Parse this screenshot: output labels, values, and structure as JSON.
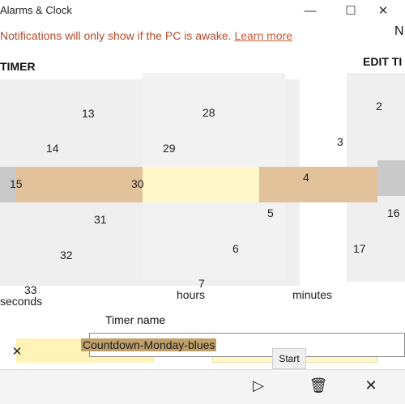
{
  "window": {
    "title": "Alarms & Clock",
    "controls": {
      "minimize": "—",
      "maximize": "☐",
      "close": "✕"
    },
    "right_initial": "N"
  },
  "notice": {
    "text": "Notifications will only show if the PC is awake.",
    "link": "Learn more"
  },
  "panels": {
    "left_header": "TIMER",
    "right_header": "EDIT TI"
  },
  "picker": {
    "left_column": [
      "13",
      "14",
      "15",
      "31",
      "32",
      "33"
    ],
    "mid_column": [
      "28",
      "29",
      "30"
    ],
    "right_column": [
      "2",
      "3",
      "4",
      "5",
      "6",
      "7"
    ],
    "far_right_column": [
      "16",
      "17"
    ],
    "labels": {
      "seconds": "seconds",
      "hours": "hours",
      "minutes": "minutes"
    }
  },
  "form": {
    "timer_name_label": "Timer name",
    "timer_name_value": "Countdown-Monday-blues",
    "start_label": "Start"
  },
  "icons": {
    "clear": "✕",
    "play": "▷",
    "delete": "🗑",
    "close": "✕"
  },
  "colors": {
    "highlight": "#e2c29a",
    "yellow": "#fff6c9",
    "link": "#c85a37"
  }
}
